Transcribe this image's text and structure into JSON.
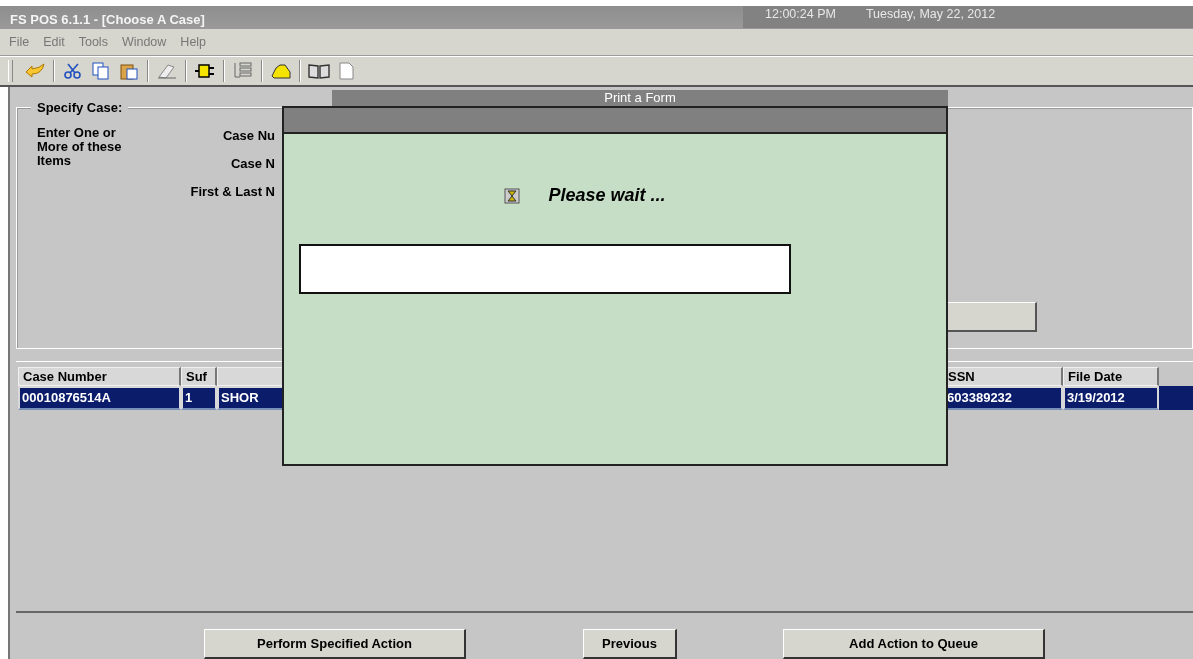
{
  "window": {
    "title": "FS POS 6.1.1 - [Choose A Case]",
    "time": "12:00:24 PM",
    "date": "Tuesday, May 22, 2012"
  },
  "menu": [
    "File",
    "Edit",
    "Tools",
    "Window",
    "Help"
  ],
  "specify_case": {
    "legend": "Specify Case:",
    "hint": "Enter One or More of these Items",
    "labels": [
      "Case Nu",
      "Case N",
      "First & Last N"
    ]
  },
  "table": {
    "columns": [
      {
        "label": "Case Number"
      },
      {
        "label": "Suf"
      },
      {},
      {
        "label": "SSN"
      },
      {
        "label": "File Date"
      }
    ],
    "rows": [
      {
        "cells": [
          "00010876514A",
          "1",
          "SHOR",
          "603389232",
          "3/19/2012"
        ],
        "selected": true
      }
    ]
  },
  "buttons": [
    "Perform Specified Action",
    "Previous",
    "Add Action to Queue"
  ],
  "background_window": {
    "title": "Print a Form"
  },
  "dialog": {
    "message": "Please wait ..."
  }
}
